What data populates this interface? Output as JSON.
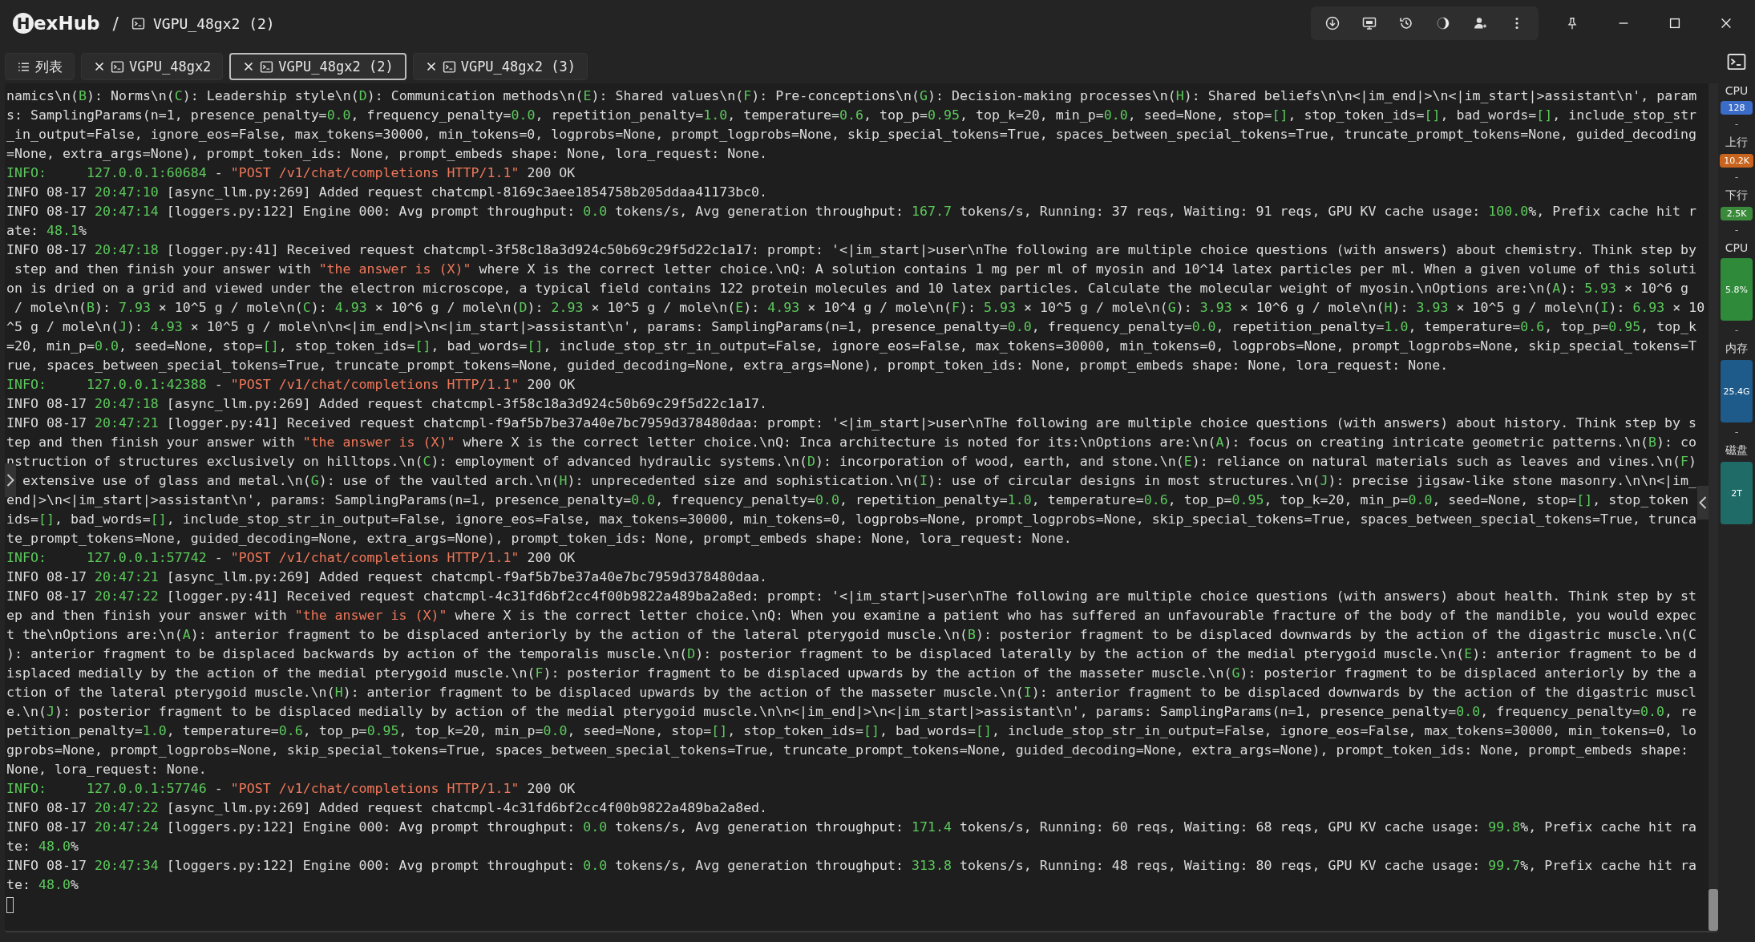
{
  "logo": {
    "mark": "H",
    "text": "exHub"
  },
  "breadcrumb": {
    "separator": "/",
    "title": "VGPU_48gx2 (2)"
  },
  "tabs": [
    {
      "label": "列表",
      "kind": "list",
      "selected": false
    },
    {
      "label": "VGPU_48gx2",
      "kind": "terminal",
      "selected": false
    },
    {
      "label": "VGPU_48gx2 (2)",
      "kind": "terminal",
      "selected": true
    },
    {
      "label": "VGPU_48gx2 (3)",
      "kind": "terminal",
      "selected": false
    }
  ],
  "terminal": {
    "lines": [
      "namics\\n(B): Norms\\n(C): Leadership style\\n(D): Communication methods\\n(E): Shared values\\n(F): Pre-conceptions\\n(G): Decision-making processes\\n(H): Shared beliefs\\n\\n<|im_end|>\\n<|im_start|>assistant\\n', param",
      "s: SamplingParams(n=1, presence_penalty=0.0, frequency_penalty=0.0, repetition_penalty=1.0, temperature=0.6, top_p=0.95, top_k=20, min_p=0.0, seed=None, stop=[], stop_token_ids=[], bad_words=[], include_stop_str",
      "_in_output=False, ignore_eos=False, max_tokens=30000, min_tokens=0, logprobs=None, prompt_logprobs=None, skip_special_tokens=True, spaces_between_special_tokens=True, truncate_prompt_tokens=None, guided_decoding",
      "=None, extra_args=None), prompt_token_ids: None, prompt_embeds shape: None, lora_request: None.",
      "INFO:     127.0.0.1:60684 - \"POST /v1/chat/completions HTTP/1.1\" 200 OK",
      "INFO 08-17 20:47:10 [async_llm.py:269] Added request chatcmpl-8169c3aee1854758b205ddaa41173bc0.",
      "INFO 08-17 20:47:14 [loggers.py:122] Engine 000: Avg prompt throughput: 0.0 tokens/s, Avg generation throughput: 167.7 tokens/s, Running: 37 reqs, Waiting: 91 reqs, GPU KV cache usage: 100.0%, Prefix cache hit r",
      "ate: 48.1%",
      "INFO 08-17 20:47:18 [logger.py:41] Received request chatcmpl-3f58c18a3d924c50b69c29f5d22c1a17: prompt: '<|im_start|>user\\nThe following are multiple choice questions (with answers) about chemistry. Think step by",
      " step and then finish your answer with \"the answer is (X)\" where X is the correct letter choice.\\nQ: A solution contains 1 mg per ml of myosin and 10^14 latex particles per ml. When a given volume of this soluti",
      "on is dried on a grid and viewed under the electron microscope, a typical field contains 122 protein molecules and 10 latex particles. Calculate the molecular weight of myosin.\\nOptions are:\\n(A): 5.93 × 10^6 g",
      " / mole\\n(B): 7.93 × 10^5 g / mole\\n(C): 4.93 × 10^6 g / mole\\n(D): 2.93 × 10^5 g / mole\\n(E): 4.93 × 10^4 g / mole\\n(F): 5.93 × 10^5 g / mole\\n(G): 3.93 × 10^6 g / mole\\n(H): 3.93 × 10^5 g / mole\\n(I): 6.93 × 10",
      "^5 g / mole\\n(J): 4.93 × 10^5 g / mole\\n\\n<|im_end|>\\n<|im_start|>assistant\\n', params: SamplingParams(n=1, presence_penalty=0.0, frequency_penalty=0.0, repetition_penalty=1.0, temperature=0.6, top_p=0.95, top_k",
      "=20, min_p=0.0, seed=None, stop=[], stop_token_ids=[], bad_words=[], include_stop_str_in_output=False, ignore_eos=False, max_tokens=30000, min_tokens=0, logprobs=None, prompt_logprobs=None, skip_special_tokens=T",
      "rue, spaces_between_special_tokens=True, truncate_prompt_tokens=None, guided_decoding=None, extra_args=None), prompt_token_ids: None, prompt_embeds shape: None, lora_request: None.",
      "INFO:     127.0.0.1:42388 - \"POST /v1/chat/completions HTTP/1.1\" 200 OK",
      "INFO 08-17 20:47:18 [async_llm.py:269] Added request chatcmpl-3f58c18a3d924c50b69c29f5d22c1a17.",
      "INFO 08-17 20:47:21 [logger.py:41] Received request chatcmpl-f9af5b7be37a40e7bc7959d378480daa: prompt: '<|im_start|>user\\nThe following are multiple choice questions (with answers) about history. Think step by s",
      "tep and then finish your answer with \"the answer is (X)\" where X is the correct letter choice.\\nQ: Inca architecture is noted for its:\\nOptions are:\\n(A): focus on creating intricate geometric patterns.\\n(B): co",
      "nstruction of structures exclusively on hilltops.\\n(C): employment of advanced hydraulic systems.\\n(D): incorporation of wood, earth, and stone.\\n(E): reliance on natural materials such as leaves and vines.\\n(F)",
      "  extensive use of glass and metal.\\n(G): use of the vaulted arch.\\n(H): unprecedented size and sophistication.\\n(I): use of circular designs in most structures.\\n(J): precise jigsaw-like stone masonry.\\n\\n<|im_",
      "end|>\\n<|im_start|>assistant\\n', params: SamplingParams(n=1, presence_penalty=0.0, frequency_penalty=0.0, repetition_penalty=1.0, temperature=0.6, top_p=0.95, top_k=20, min_p=0.0, seed=None, stop=[], stop_token",
      "ids=[], bad_words=[], include_stop_str_in_output=False, ignore_eos=False, max_tokens=30000, min_tokens=0, logprobs=None, prompt_logprobs=None, skip_special_tokens=True, spaces_between_special_tokens=True, trunca",
      "te_prompt_tokens=None, guided_decoding=None, extra_args=None), prompt_token_ids: None, prompt_embeds shape: None, lora_request: None.",
      "INFO:     127.0.0.1:57742 - \"POST /v1/chat/completions HTTP/1.1\" 200 OK",
      "INFO 08-17 20:47:21 [async_llm.py:269] Added request chatcmpl-f9af5b7be37a40e7bc7959d378480daa.",
      "INFO 08-17 20:47:22 [logger.py:41] Received request chatcmpl-4c31fd6bf2cc4f00b9822a489ba2a8ed: prompt: '<|im_start|>user\\nThe following are multiple choice questions (with answers) about health. Think step by st",
      "ep and then finish your answer with \"the answer is (X)\" where X is the correct letter choice.\\nQ: When you examine a patient who has suffered an unfavourable fracture of the body of the mandible, you would expec",
      "t the\\nOptions are:\\n(A): anterior fragment to be displaced anteriorly by the action of the lateral pterygoid muscle.\\n(B): posterior fragment to be displaced downwards by the action of the digastric muscle.\\n(C",
      "): anterior fragment to be displaced backwards by action of the temporalis muscle.\\n(D): posterior fragment to be displaced laterally by the action of the medial pterygoid muscle.\\n(E): anterior fragment to be d",
      "isplaced medially by the action of the medial pterygoid muscle.\\n(F): posterior fragment to be displaced upwards by the action of the masseter muscle.\\n(G): posterior fragment to be displaced anteriorly by the a",
      "ction of the lateral pterygoid muscle.\\n(H): anterior fragment to be displaced upwards by the action of the masseter muscle.\\n(I): anterior fragment to be displaced downwards by the action of the digastric muscl",
      "e.\\n(J): posterior fragment to be displaced medially by action of the medial pterygoid muscle.\\n\\n<|im_end|>\\n<|im_start|>assistant\\n', params: SamplingParams(n=1, presence_penalty=0.0, frequency_penalty=0.0, re",
      "petition_penalty=1.0, temperature=0.6, top_p=0.95, top_k=20, min_p=0.0, seed=None, stop=[], stop_token_ids=[], bad_words=[], include_stop_str_in_output=False, ignore_eos=False, max_tokens=30000, min_tokens=0, lo",
      "gprobs=None, prompt_logprobs=None, skip_special_tokens=True, spaces_between_special_tokens=True, truncate_prompt_tokens=None, guided_decoding=None, extra_args=None), prompt_token_ids: None, prompt_embeds shape:",
      "None, lora_request: None.",
      "INFO:     127.0.0.1:57746 - \"POST /v1/chat/completions HTTP/1.1\" 200 OK",
      "INFO 08-17 20:47:22 [async_llm.py:269] Added request chatcmpl-4c31fd6bf2cc4f00b9822a489ba2a8ed.",
      "INFO 08-17 20:47:24 [loggers.py:122] Engine 000: Avg prompt throughput: 0.0 tokens/s, Avg generation throughput: 171.4 tokens/s, Running: 60 reqs, Waiting: 68 reqs, GPU KV cache usage: 99.8%, Prefix cache hit ra",
      "te: 48.0%",
      "INFO 08-17 20:47:34 [loggers.py:122] Engine 000: Avg prompt throughput: 0.0 tokens/s, Avg generation throughput: 313.8 tokens/s, Running: 48 reqs, Waiting: 80 reqs, GPU KV cache usage: 99.7%, Prefix cache hit ra",
      "te: 48.0%"
    ]
  },
  "monitor": [
    {
      "label": "CPU",
      "value": "128",
      "kind": "badge",
      "color": "#3a6cc8",
      "dash": "-"
    },
    {
      "label": "上行",
      "value": "10.2K",
      "kind": "badge",
      "color": "#c8641e",
      "dash": "-"
    },
    {
      "label": "下行",
      "value": "2.5K",
      "kind": "badge",
      "color": "#3b8a3b",
      "dash": "-"
    },
    {
      "label": "CPU",
      "value": "5.8%",
      "kind": "bar",
      "color": "#2f8a3a",
      "dash": "-"
    },
    {
      "label": "内存",
      "value": "25.4G",
      "kind": "bar",
      "color": "#1e5a8a",
      "dash": "-"
    },
    {
      "label": "磁盘",
      "value": "2T",
      "kind": "bar",
      "color": "#1f6b68"
    }
  ]
}
